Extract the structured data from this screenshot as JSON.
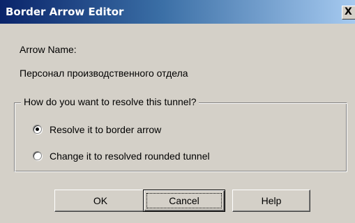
{
  "window": {
    "title": "Border Arrow Editor",
    "close_glyph": "X"
  },
  "arrow_name": {
    "label": "Arrow Name:",
    "value": "Персонал производственного отдела"
  },
  "resolve_group": {
    "legend": "How do you want to resolve this tunnel?",
    "options": [
      {
        "label": "Resolve it to border arrow",
        "selected": true
      },
      {
        "label": "Change it to resolved rounded tunnel",
        "selected": false
      }
    ]
  },
  "buttons": {
    "ok": "OK",
    "cancel": "Cancel",
    "help": "Help"
  }
}
